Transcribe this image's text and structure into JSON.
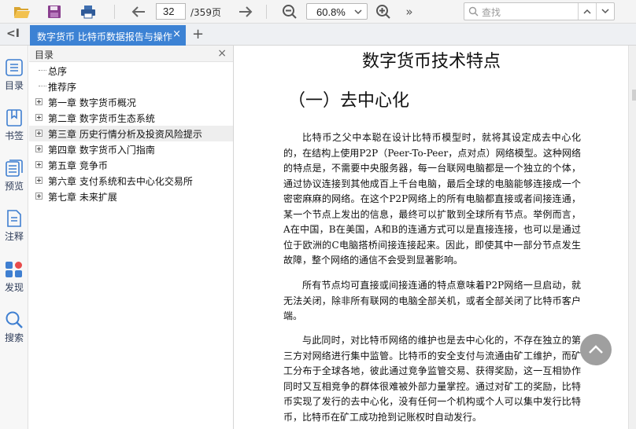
{
  "toolbar": {
    "open_icon": "folder-open-icon",
    "save_icon": "save-icon",
    "print_icon": "print-icon",
    "current_page": "32",
    "total_pages": "/359页",
    "zoom": "60.8%",
    "search_placeholder": "查找",
    "more": "»"
  },
  "tabs": {
    "collapse": "<I",
    "active_tab": "数字货币 比特币数据报告与操作",
    "close": "×",
    "add": "+"
  },
  "rail": {
    "items": [
      {
        "label": "目录",
        "icon": "list-icon"
      },
      {
        "label": "书签",
        "icon": "bookmark-icon"
      },
      {
        "label": "预览",
        "icon": "pages-icon"
      },
      {
        "label": "注释",
        "icon": "note-icon"
      },
      {
        "label": "发现",
        "icon": "discover-icon"
      },
      {
        "label": "搜索",
        "icon": "search-icon"
      }
    ]
  },
  "outline": {
    "title": "目录",
    "close": "×",
    "items": [
      {
        "label": "总序",
        "expandable": false
      },
      {
        "label": "推荐序",
        "expandable": false
      },
      {
        "label": "第一章 数字货币概况",
        "expandable": true
      },
      {
        "label": "第二章 数字货币生态系统",
        "expandable": true
      },
      {
        "label": "第三章 历史行情分析及投资风险提示",
        "expandable": true,
        "selected": true
      },
      {
        "label": "第四章 数字货币入门指南",
        "expandable": true
      },
      {
        "label": "第五章 竞争币",
        "expandable": true
      },
      {
        "label": "第六章 支付系统和去中心化交易所",
        "expandable": true
      },
      {
        "label": "第七章 未来扩展",
        "expandable": true
      }
    ]
  },
  "document": {
    "title": "数字货币技术特点",
    "heading": "（一）去中心化",
    "paragraphs": [
      "比特币之父中本聪在设计比特币模型时，就将其设定成去中心化的，在结构上使用P2P（Peer-To-Peer，点对点）网络模型。这种网络的特点是，不需要中央服务器，每一台联网电脑都是一个独立的个体，通过协议连接到其他成百上千台电脑，最后全球的电脑能够连接成一个密密麻麻的网络。在这个P2P网络上的所有电脑都直接或者间接连通，某一个节点上发出的信息，最终可以扩散到全球所有节点。举例而言，A在中国，B在美国，A和B的连通方式可以是直接连接，也可以是通过位于欧洲的C电脑搭桥间接连接起来。因此，即使其中一部分节点发生故障，整个网络的通信不会受到显著影响。",
      "所有节点均可直接或间接连通的特点意味着P2P网络一旦启动，就无法关闭，除非所有联网的电脑全部关机，或者全部关闭了比特币客户端。",
      "与此同时，对比特币网络的维护也是去中心化的，不存在独立的第三方对网络进行集中监管。比特币的安全支付与流通由矿工维护，而矿工分布于全球各地，彼此通过竞争监管交易、获得奖励，这一互相协作同时又互相竞争的群体很难被外部力量掌控。通过对矿工的奖励，比特币实现了发行的去中心化，没有任何一个机构或个人可以集中发行比特币，比特币在矿工成功抢到记账权时自动发行。"
    ]
  },
  "colors": {
    "tab_active": "#3c82d4",
    "rail_text": "#2e3c59",
    "icon_blue": "#3f7fd1"
  }
}
